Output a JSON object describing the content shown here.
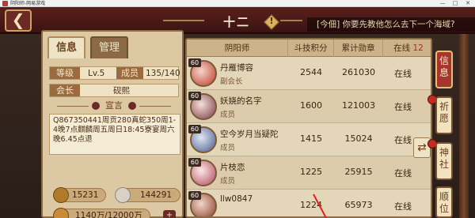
{
  "window": {
    "title": "阴阳师-网易游戏",
    "controls": [
      "—",
      "□",
      "✕"
    ]
  },
  "header": {
    "back_glyph": "❮",
    "guild_name": "十二",
    "warn_glyph": "!",
    "ticker_text": "[今佃] 你要先教他怎么去下一个海域?"
  },
  "tabs": {
    "info": "信息",
    "manage": "管理"
  },
  "info": {
    "level_label": "等级",
    "level_value": "Lv.5",
    "members_label": "成员",
    "members_value": "135/140",
    "leader_label": "会长",
    "leader_value": "砚熙",
    "declaration_title": "宣言",
    "declaration_text": "Q867350441周贡280真蛇350周1-4晚7点麒麟周五周日18:45寮宴周六晚6.45点退"
  },
  "stats": {
    "stat1": "15231",
    "stat2": "144291",
    "stat3": "1140万/12000万"
  },
  "table": {
    "headers": {
      "name": "阴阳师",
      "score": "斗技积分",
      "medals": "累计勋章",
      "online": "在线",
      "online_count": "12"
    },
    "rows": [
      {
        "level": "60",
        "name": "丹雁博容",
        "role": "副会长",
        "score": "2544",
        "medals": "261030",
        "status": "在线"
      },
      {
        "level": "60",
        "name": "妖娆的名字",
        "role": "成员",
        "score": "1600",
        "medals": "121003",
        "status": "在线"
      },
      {
        "level": "60",
        "name": "空今岁月当疑陀",
        "role": "成员",
        "score": "1415",
        "medals": "15024",
        "status": "在线"
      },
      {
        "level": "60",
        "name": "片枝恋",
        "role": "成员",
        "score": "1225",
        "medals": "25915",
        "status": "在线"
      },
      {
        "level": "60",
        "name": "llw0847",
        "role": "",
        "score": "1224",
        "medals": "65973",
        "status": "在线"
      }
    ]
  },
  "side_tabs": {
    "info": "信息",
    "pray": "祈愿",
    "shrine": "神社",
    "rank": "顺位"
  },
  "colors": {
    "accent_red": "#a7352b",
    "parchment": "#e4d6b8",
    "wood": "#8a6b43"
  }
}
